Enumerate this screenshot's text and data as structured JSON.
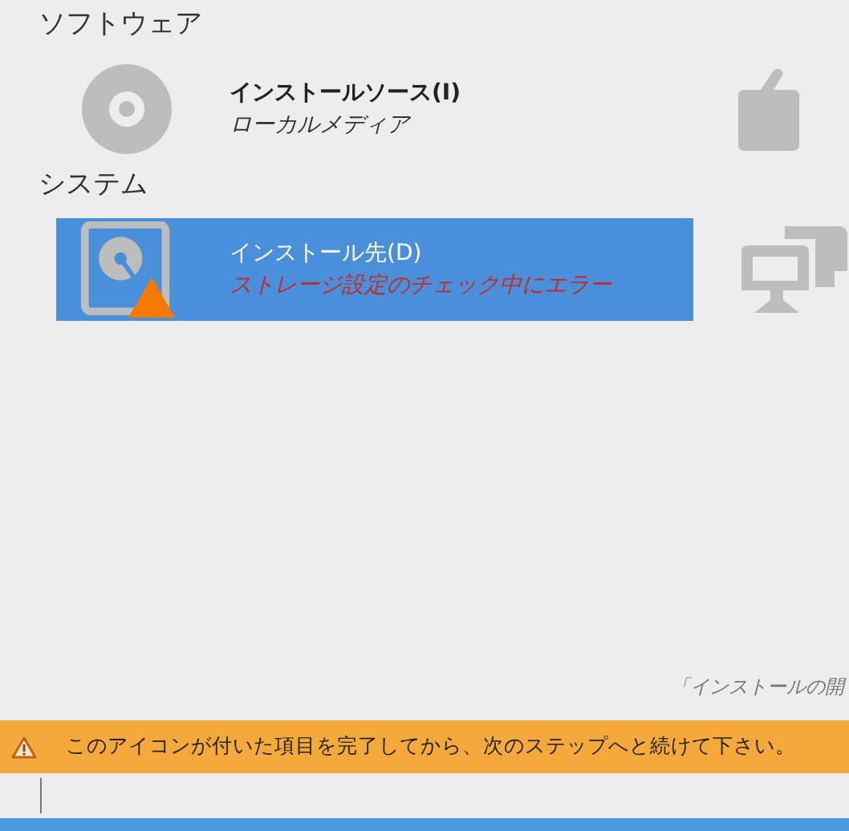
{
  "sections": [
    {
      "title": "ソフトウェア",
      "items": [
        {
          "kind": "disc",
          "title": "インストールソース(I)",
          "status": "ローカルメディア",
          "selected": false,
          "error": false
        }
      ]
    },
    {
      "title": "システム",
      "items": [
        {
          "kind": "disk",
          "title": "インストール先(D)",
          "status": "ストレージ設定のチェック中にエラー",
          "selected": true,
          "error": true
        }
      ]
    }
  ],
  "hint": "「インストールの開",
  "warning_bar": {
    "message": "このアイコンが付いた項目を完了してから、次のステップへと続けて下さい。"
  }
}
